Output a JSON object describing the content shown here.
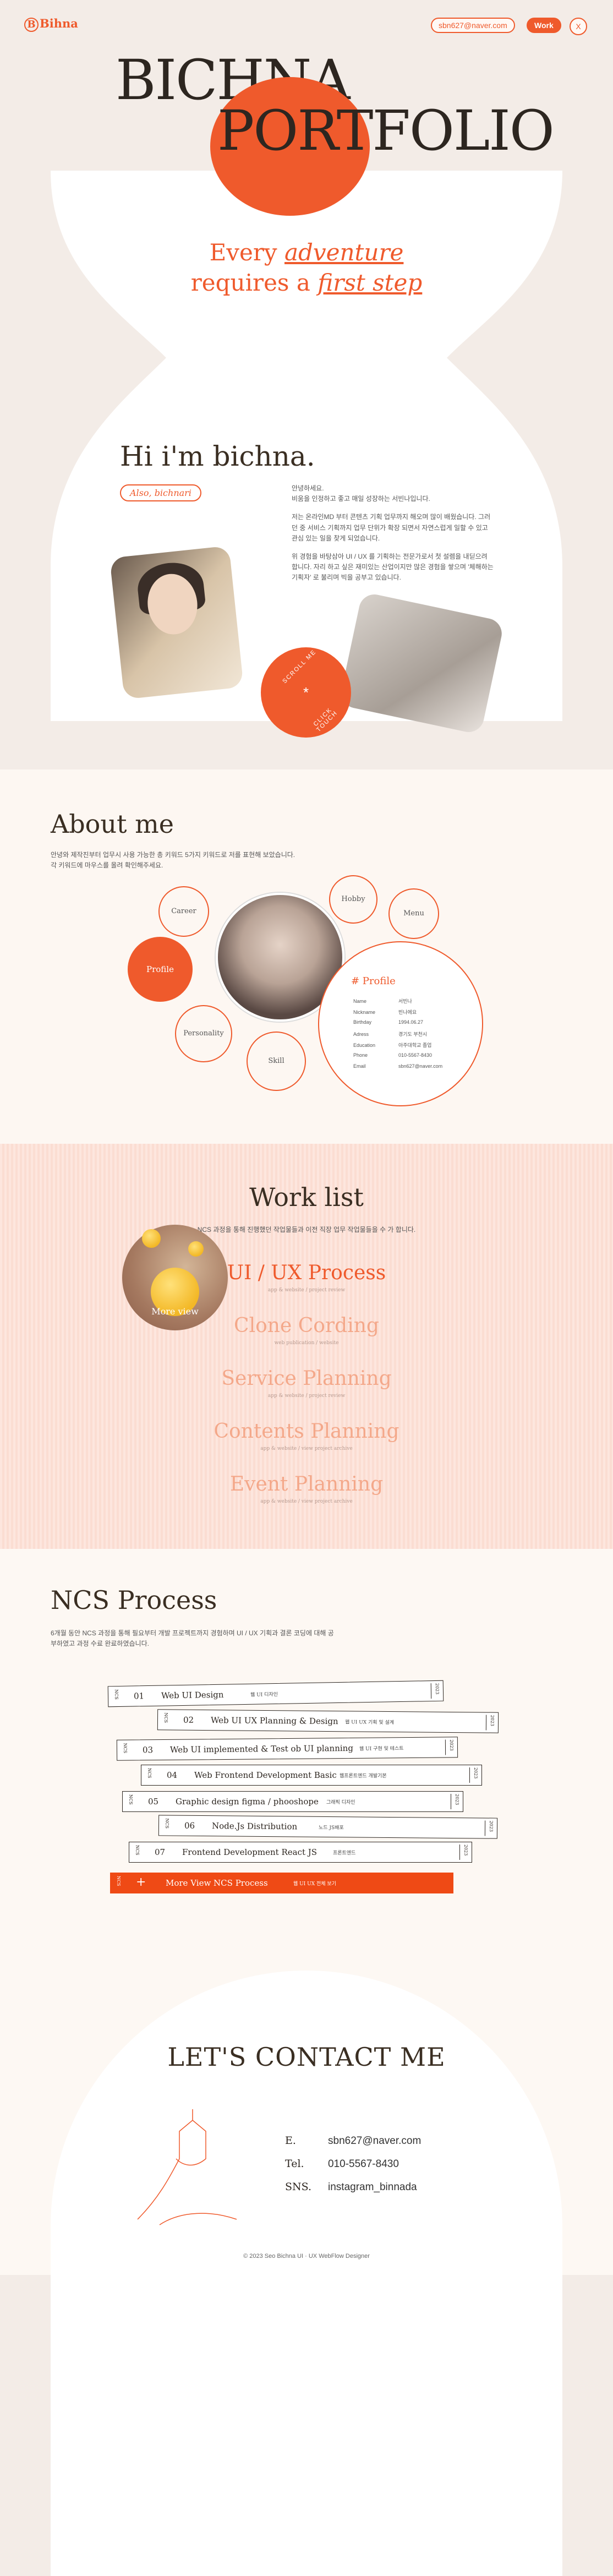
{
  "header": {
    "logo": "Bihna",
    "logo_initial": "B",
    "email": "sbn627@naver.com",
    "work": "Work",
    "close": "X"
  },
  "hero": {
    "title_line1": "BICHNA",
    "title_line2": "PORTFOLIO",
    "tagline_a": "Every",
    "tagline_b": "adventure",
    "tagline_c": "requires a",
    "tagline_d": "first step"
  },
  "intro": {
    "hi": "Hi i'm bichna.",
    "also": "Also, bichnari",
    "p1": "안녕하세요.\n비움을 인정하고 좋고 매일 성장하는 서빈나입니다.",
    "p2": "저는 온라인MD 부터 콘텐츠 기획 업무까지 해오며 많이 배웠습니다. 그러던 중 서비스 기획까지 업무 단위가 확장 되면서 자연스럽게 일할 수 있고 관심 있는 일을 찾게 되었습니다.",
    "p3": "위 경험을 바탕삼아 UI / UX 를 기획하는 전문가로서 첫 설렘을 내딛으려 합니다. 자리 하고 싶은 재미있는 산업이지만 많은 경험을 쌓으며 '체해하는 기획자' 로 불리며 빅을 공부고 있습니다.",
    "stamp_icon": "*",
    "stamp_top": "SCROLL ME",
    "stamp_bottom": "CLICK TOUCH"
  },
  "about": {
    "title": "About me",
    "desc_1": "안녕와 제작진부터 업무시 사용 가능한 총 키워드 5가지 키워드로 저를 표현해 보았습니다.",
    "desc_2": "각 키워드에 마우스를 올려 확인해주세요.",
    "bubbles": {
      "career": "Career",
      "hobby": "Hobby",
      "menu": "Menu",
      "profile": "Profile",
      "personality": "Personality",
      "skill": "Skill"
    },
    "profile": {
      "title": "# Profile",
      "rows": [
        {
          "k": "Name",
          "v": "서빈나"
        },
        {
          "k": "Nickname",
          "v": "빈나에요"
        },
        {
          "k": "Birthday",
          "v": "1994.06.27"
        },
        {
          "k": "Adress",
          "v": "경기도 부천시"
        },
        {
          "k": "Education",
          "v": "아주대학교 졸업"
        },
        {
          "k": "Phone",
          "v": "010-5567-8430"
        },
        {
          "k": "Email",
          "v": "sbn627@naver.com"
        }
      ]
    }
  },
  "work": {
    "title": "Work list",
    "desc": "NCS 과정을 통해 진행했던 작업물들과 이전 직장 업무 작업물들을 수 가 합니다.",
    "more_view": "More view",
    "items": [
      {
        "name": "UI / UX Process",
        "sub": "app & website / project review"
      },
      {
        "name": "Clone Cording",
        "sub": "web publication / website"
      },
      {
        "name": "Service Planning",
        "sub": "app & website / project review"
      },
      {
        "name": "Contents Planning",
        "sub": "app & website / view project archive"
      },
      {
        "name": "Event Planning",
        "sub": "app & website / view project archive"
      }
    ],
    "colors": {
      "accent": "#ef5a2c",
      "faded": "#f4a88a"
    }
  },
  "ncs": {
    "title": "NCS Process",
    "desc": "6개월 동안 NCS 과정을 통해 필요부터 개발 프로젝트까지 경험하며 UI / UX 기획과 결론 코딩에 대해 공부하였고 과정 수료 완료하였습니다.",
    "tabs": [
      {
        "num": "01",
        "name": "Web UI Design",
        "sub": "웹 UI 디자인",
        "yr": "2023"
      },
      {
        "num": "02",
        "name": "Web UI UX Planning & Design",
        "sub": "웹 UI UX 기획 및 설계",
        "yr": "2023"
      },
      {
        "num": "03",
        "name": "Web UI implemented & Test ob UI planning",
        "sub": "웹 UI 구현 및 테스트",
        "yr": "2023"
      },
      {
        "num": "04",
        "name": "Web Frontend Development Basic",
        "sub": "웹프론트엔드 개발기본",
        "yr": "2023"
      },
      {
        "num": "05",
        "name": "Graphic design figma / phooshope",
        "sub": "그래픽 디자인",
        "yr": "2023"
      },
      {
        "num": "06",
        "name": "Node.Js Distribution",
        "sub": "노드 JS배포",
        "yr": "2023"
      },
      {
        "num": "07",
        "name": "Frontend Development React JS",
        "sub": "프론트엔드",
        "yr": "2023"
      }
    ],
    "ncs_label": "NCS",
    "more_plus": "+",
    "more": "More View NCS Process",
    "more_sub": "웹 UI UX 전체 보기"
  },
  "contact": {
    "title": "LET'S CONTACT ME",
    "rows": [
      {
        "k": "E.",
        "v": "sbn627@naver.com"
      },
      {
        "k": "Tel.",
        "v": "010-5567-8430"
      },
      {
        "k": "SNS.",
        "v": "instagram_binnada"
      }
    ],
    "footer": "© 2023 Seo Bichna UI · UX WebFlow Designer"
  }
}
